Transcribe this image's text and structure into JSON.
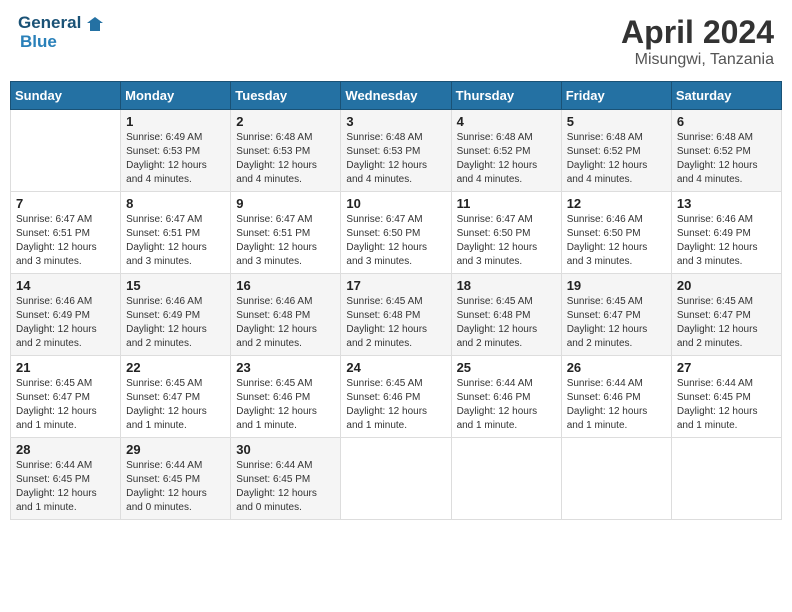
{
  "header": {
    "logo_line1": "General",
    "logo_line2": "Blue",
    "title": "April 2024",
    "subtitle": "Misungwi, Tanzania"
  },
  "days_of_week": [
    "Sunday",
    "Monday",
    "Tuesday",
    "Wednesday",
    "Thursday",
    "Friday",
    "Saturday"
  ],
  "weeks": [
    [
      {
        "day": "",
        "info": ""
      },
      {
        "day": "1",
        "info": "Sunrise: 6:49 AM\nSunset: 6:53 PM\nDaylight: 12 hours\nand 4 minutes."
      },
      {
        "day": "2",
        "info": "Sunrise: 6:48 AM\nSunset: 6:53 PM\nDaylight: 12 hours\nand 4 minutes."
      },
      {
        "day": "3",
        "info": "Sunrise: 6:48 AM\nSunset: 6:53 PM\nDaylight: 12 hours\nand 4 minutes."
      },
      {
        "day": "4",
        "info": "Sunrise: 6:48 AM\nSunset: 6:52 PM\nDaylight: 12 hours\nand 4 minutes."
      },
      {
        "day": "5",
        "info": "Sunrise: 6:48 AM\nSunset: 6:52 PM\nDaylight: 12 hours\nand 4 minutes."
      },
      {
        "day": "6",
        "info": "Sunrise: 6:48 AM\nSunset: 6:52 PM\nDaylight: 12 hours\nand 4 minutes."
      }
    ],
    [
      {
        "day": "7",
        "info": "Sunrise: 6:47 AM\nSunset: 6:51 PM\nDaylight: 12 hours\nand 3 minutes."
      },
      {
        "day": "8",
        "info": "Sunrise: 6:47 AM\nSunset: 6:51 PM\nDaylight: 12 hours\nand 3 minutes."
      },
      {
        "day": "9",
        "info": "Sunrise: 6:47 AM\nSunset: 6:51 PM\nDaylight: 12 hours\nand 3 minutes."
      },
      {
        "day": "10",
        "info": "Sunrise: 6:47 AM\nSunset: 6:50 PM\nDaylight: 12 hours\nand 3 minutes."
      },
      {
        "day": "11",
        "info": "Sunrise: 6:47 AM\nSunset: 6:50 PM\nDaylight: 12 hours\nand 3 minutes."
      },
      {
        "day": "12",
        "info": "Sunrise: 6:46 AM\nSunset: 6:50 PM\nDaylight: 12 hours\nand 3 minutes."
      },
      {
        "day": "13",
        "info": "Sunrise: 6:46 AM\nSunset: 6:49 PM\nDaylight: 12 hours\nand 3 minutes."
      }
    ],
    [
      {
        "day": "14",
        "info": "Sunrise: 6:46 AM\nSunset: 6:49 PM\nDaylight: 12 hours\nand 2 minutes."
      },
      {
        "day": "15",
        "info": "Sunrise: 6:46 AM\nSunset: 6:49 PM\nDaylight: 12 hours\nand 2 minutes."
      },
      {
        "day": "16",
        "info": "Sunrise: 6:46 AM\nSunset: 6:48 PM\nDaylight: 12 hours\nand 2 minutes."
      },
      {
        "day": "17",
        "info": "Sunrise: 6:45 AM\nSunset: 6:48 PM\nDaylight: 12 hours\nand 2 minutes."
      },
      {
        "day": "18",
        "info": "Sunrise: 6:45 AM\nSunset: 6:48 PM\nDaylight: 12 hours\nand 2 minutes."
      },
      {
        "day": "19",
        "info": "Sunrise: 6:45 AM\nSunset: 6:47 PM\nDaylight: 12 hours\nand 2 minutes."
      },
      {
        "day": "20",
        "info": "Sunrise: 6:45 AM\nSunset: 6:47 PM\nDaylight: 12 hours\nand 2 minutes."
      }
    ],
    [
      {
        "day": "21",
        "info": "Sunrise: 6:45 AM\nSunset: 6:47 PM\nDaylight: 12 hours\nand 1 minute."
      },
      {
        "day": "22",
        "info": "Sunrise: 6:45 AM\nSunset: 6:47 PM\nDaylight: 12 hours\nand 1 minute."
      },
      {
        "day": "23",
        "info": "Sunrise: 6:45 AM\nSunset: 6:46 PM\nDaylight: 12 hours\nand 1 minute."
      },
      {
        "day": "24",
        "info": "Sunrise: 6:45 AM\nSunset: 6:46 PM\nDaylight: 12 hours\nand 1 minute."
      },
      {
        "day": "25",
        "info": "Sunrise: 6:44 AM\nSunset: 6:46 PM\nDaylight: 12 hours\nand 1 minute."
      },
      {
        "day": "26",
        "info": "Sunrise: 6:44 AM\nSunset: 6:46 PM\nDaylight: 12 hours\nand 1 minute."
      },
      {
        "day": "27",
        "info": "Sunrise: 6:44 AM\nSunset: 6:45 PM\nDaylight: 12 hours\nand 1 minute."
      }
    ],
    [
      {
        "day": "28",
        "info": "Sunrise: 6:44 AM\nSunset: 6:45 PM\nDaylight: 12 hours\nand 1 minute."
      },
      {
        "day": "29",
        "info": "Sunrise: 6:44 AM\nSunset: 6:45 PM\nDaylight: 12 hours\nand 0 minutes."
      },
      {
        "day": "30",
        "info": "Sunrise: 6:44 AM\nSunset: 6:45 PM\nDaylight: 12 hours\nand 0 minutes."
      },
      {
        "day": "",
        "info": ""
      },
      {
        "day": "",
        "info": ""
      },
      {
        "day": "",
        "info": ""
      },
      {
        "day": "",
        "info": ""
      }
    ]
  ]
}
